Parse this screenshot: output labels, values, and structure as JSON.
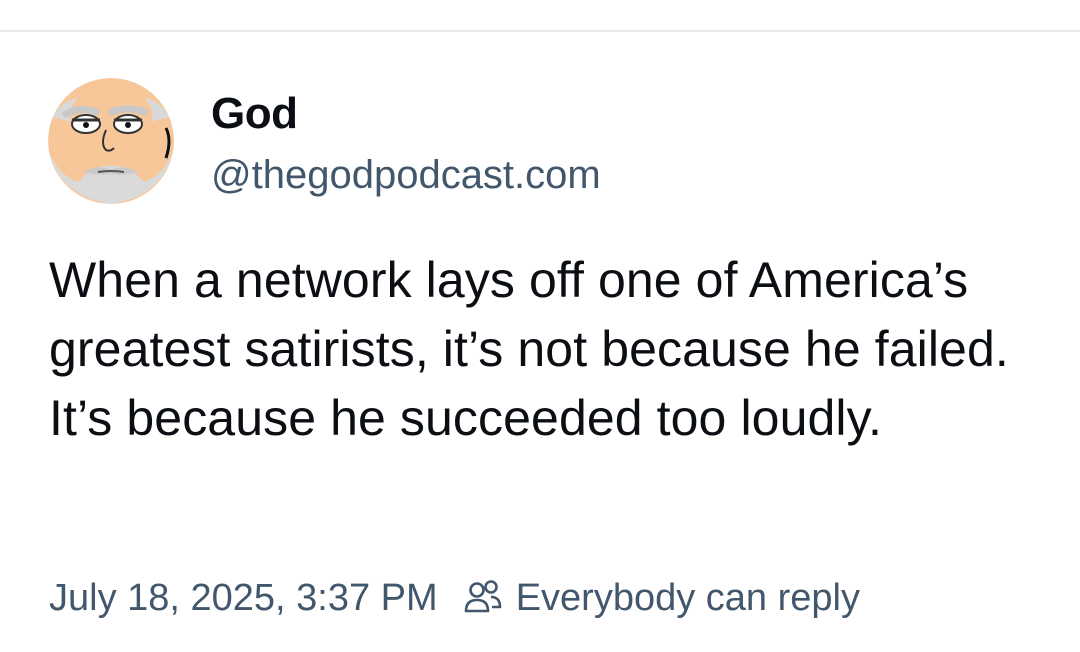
{
  "post": {
    "author": {
      "display_name": "God",
      "handle": "@thegodpodcast.com",
      "avatar_icon": "cartoon-bald-face-avatar"
    },
    "text": "When a network lays off one of America’s greatest satirists, it’s not because he failed. It’s because he succeeded too loudly.",
    "timestamp": "July 18, 2025, 3:37 PM",
    "reply_setting": {
      "icon": "people-icon",
      "label": "Everybody can reply"
    }
  },
  "colors": {
    "text_primary": "#0b0f14",
    "text_secondary": "#42576c",
    "divider": "#e6eaee",
    "avatar_skin": "#f7c79a",
    "avatar_beard": "#d9d9d9"
  }
}
